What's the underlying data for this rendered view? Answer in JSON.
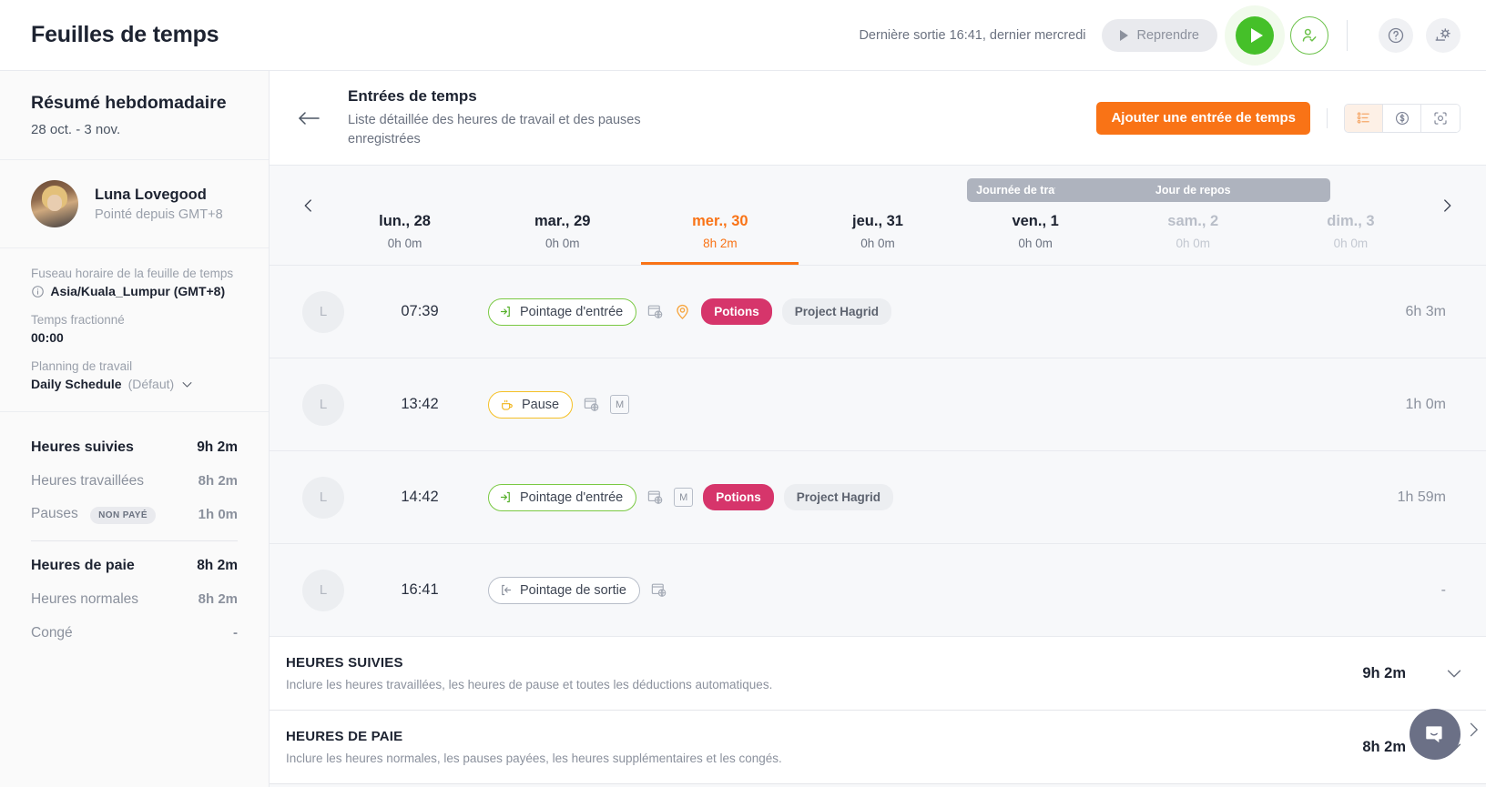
{
  "topbar": {
    "app_title": "Feuilles de temps",
    "last_out_text": "Dernière sortie 16:41, dernier mercredi",
    "resume_label": "Reprendre",
    "play_icon": "play-icon",
    "person_check_icon": "person-check-icon",
    "help_icon": "question-mark-icon",
    "settings_icon": "settings-gear-icon",
    "accent_green": "#45c029",
    "accent_orange": "#f97316"
  },
  "sidebar": {
    "summary_title": "Résumé hebdomadaire",
    "date_range": "28 oct. - 3 nov.",
    "user": {
      "name": "Luna Lovegood",
      "subtitle": "Pointé depuis GMT+8"
    },
    "meta": [
      {
        "label": "Fuseau horaire de la feuille de temps",
        "value": "Asia/Kuala_Lumpur (GMT+8)",
        "has_info_icon": true
      },
      {
        "label": "Temps fractionné",
        "value": "00:00",
        "has_info_icon": false
      },
      {
        "label": "Planning de travail",
        "value": "Daily Schedule",
        "suffix": "(Défaut)",
        "has_info_icon": false
      }
    ],
    "stats": [
      {
        "name": "Heures suivies",
        "value": "9h 2m",
        "strong": true
      },
      {
        "name": "Heures travaillées",
        "value": "8h 2m",
        "strong": false
      },
      {
        "name": "Pauses",
        "value": "1h 0m",
        "strong": false,
        "pill": "NON PAYÉ"
      },
      {
        "name": "Heures de paie",
        "value": "8h 2m",
        "strong": true
      },
      {
        "name": "Heures normales",
        "value": "8h 2m",
        "strong": false
      },
      {
        "name": "Congé",
        "value": "-",
        "strong": false
      }
    ]
  },
  "main": {
    "back_icon": "back-arrow-icon",
    "title": "Entrées de temps",
    "subtitle": "Liste détaillée des heures de travail et des pauses enregistrées",
    "add_entry_label": "Ajouter une entrée de temps",
    "view_toggles": [
      {
        "icon": "list-view-icon",
        "active": true
      },
      {
        "icon": "dollar-view-icon",
        "active": false
      },
      {
        "icon": "screenshot-view-icon",
        "active": false
      }
    ],
    "days": [
      {
        "name": "lun., 28",
        "hours": "0h 0m",
        "active": false,
        "muted": false,
        "tag": null
      },
      {
        "name": "mar., 29",
        "hours": "0h 0m",
        "active": false,
        "muted": false,
        "tag": null
      },
      {
        "name": "mer., 30",
        "hours": "8h 2m",
        "active": true,
        "muted": false,
        "tag": null
      },
      {
        "name": "jeu., 31",
        "hours": "0h 0m",
        "active": false,
        "muted": false,
        "tag": null
      },
      {
        "name": "ven., 1",
        "hours": "0h 0m",
        "active": false,
        "muted": false,
        "tag": "Journée de travail éc..."
      },
      {
        "name": "sam., 2",
        "hours": "0h 0m",
        "active": false,
        "muted": true,
        "tag": "Jour de repos"
      },
      {
        "name": "dim., 3",
        "hours": "0h 0m",
        "active": false,
        "muted": true,
        "tag": null
      }
    ],
    "prev_icon": "chevron-left-icon",
    "next_icon": "chevron-right-icon",
    "entries": [
      {
        "avatar_letter": "L",
        "time": "07:39",
        "chip_label": "Pointage d'entrée",
        "chip_type": "in",
        "icons": [
          "browser-globe-icon",
          "location-pin-icon"
        ],
        "badges": [
          {
            "text": "Potions",
            "kind": "potions"
          },
          {
            "text": "Project Hagrid",
            "kind": "project"
          }
        ],
        "duration": "6h 3m"
      },
      {
        "avatar_letter": "L",
        "time": "13:42",
        "chip_label": "Pause",
        "chip_type": "pause",
        "icons": [
          "browser-globe-icon",
          "manual-entry-icon"
        ],
        "badges": [],
        "duration": "1h 0m"
      },
      {
        "avatar_letter": "L",
        "time": "14:42",
        "chip_label": "Pointage d'entrée",
        "chip_type": "in",
        "icons": [
          "browser-globe-icon",
          "manual-entry-icon"
        ],
        "badges": [
          {
            "text": "Potions",
            "kind": "potions"
          },
          {
            "text": "Project Hagrid",
            "kind": "project"
          }
        ],
        "duration": "1h 59m"
      },
      {
        "avatar_letter": "L",
        "time": "16:41",
        "chip_label": "Pointage de sortie",
        "chip_type": "out",
        "icons": [
          "browser-globe-icon"
        ],
        "badges": [],
        "duration": "-"
      }
    ],
    "summaries": [
      {
        "title": "HEURES SUIVIES",
        "subtitle": "Inclure les heures travaillées, les heures de pause et toutes les déductions automatiques.",
        "value": "9h 2m"
      },
      {
        "title": "HEURES DE PAIE",
        "subtitle": "Inclure les heures normales, les pauses payées, les heures supplémentaires et les congés.",
        "value": "8h 2m"
      }
    ]
  },
  "chat_widget": {
    "icon": "chat-bubble-icon",
    "color": "#6b7086"
  }
}
